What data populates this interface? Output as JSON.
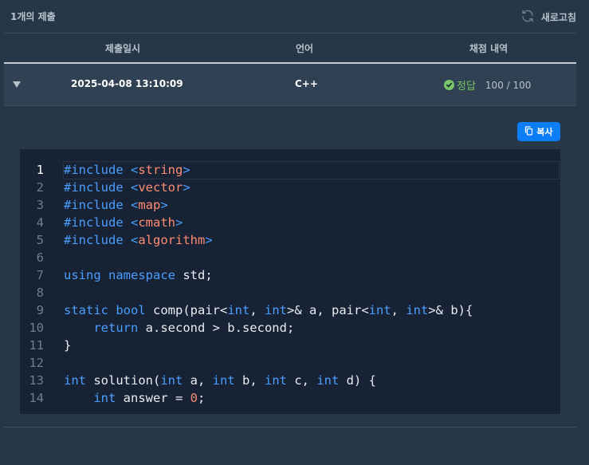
{
  "header": {
    "count_text": "1개의 제출",
    "refresh_label": "새로고침"
  },
  "table": {
    "columns": [
      "제출일시",
      "언어",
      "채점 내역"
    ],
    "row": {
      "date": "2025-04-08 13:10:09",
      "language": "C++",
      "status": "정답",
      "score": "100 / 100"
    }
  },
  "copy_button": "복사",
  "code": {
    "line_numbers": [
      "1",
      "2",
      "3",
      "4",
      "5",
      "6",
      "7",
      "8",
      "9",
      "10",
      "11",
      "12",
      "13",
      "14"
    ],
    "lines": [
      "#include <string>",
      "#include <vector>",
      "#include <map>",
      "#include <cmath>",
      "#include <algorithm>",
      "",
      "using namespace std;",
      "",
      "static bool comp(pair<int, int>& a, pair<int, int>& b){",
      "    return a.second > b.second;",
      "}",
      "",
      "int solution(int a, int b, int c, int d) {",
      "    int answer = 0;"
    ]
  },
  "colors": {
    "accent": "#0b7ef7",
    "success": "#79c66a",
    "keyword": "#4a9eff",
    "string": "#ff8c72"
  }
}
